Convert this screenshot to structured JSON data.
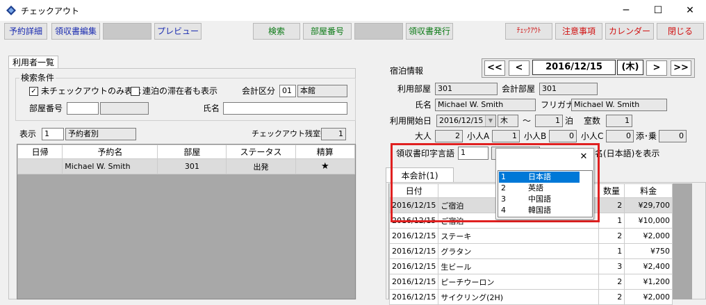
{
  "window": {
    "title": "チェックアウト",
    "minimize": "─",
    "maximize": "☐",
    "close": "✕"
  },
  "toolbar": {
    "reservation_detail": "予約詳細",
    "receipt_edit": "領収書編集",
    "preview": "プレビュー",
    "search": "検索",
    "room_number": "部屋番号",
    "issue_receipt": "領収書発行",
    "checkout": "ﾁｪｯｸｱｳﾄ",
    "notes": "注意事項",
    "calendar": "カレンダー",
    "close": "閉じる"
  },
  "left": {
    "tab": "利用者一覧",
    "search_group": "検索条件",
    "chk_unchecked_only": "未チェックアウトのみ表示",
    "chk_unchecked_only_checked": "✓",
    "chk_consecutive": "連泊の滞在者も表示",
    "account_label": "会計区分",
    "account_code": "01",
    "account_name": "本館",
    "room_label": "部屋番号",
    "name_label": "氏名",
    "display_label": "表示",
    "display_value": "1",
    "display_name": "予約者別",
    "remaining_label": "チェックアウト残室数",
    "remaining_value": "1",
    "headers": [
      "日帰",
      "予約名",
      "部屋",
      "ステータス",
      "精算"
    ],
    "rows": [
      {
        "day": "",
        "name": "Michael W. Smith",
        "room": "301",
        "status": "出発",
        "paid": "★"
      }
    ]
  },
  "right": {
    "stay_info": "宿泊情報",
    "nav": {
      "first": "<<",
      "prev": "<",
      "date": "2016/12/15",
      "dow": "(木)",
      "next": ">",
      "last": ">>"
    },
    "room_label": "利用部屋",
    "room_value": "301",
    "acct_room_label": "会計部屋",
    "acct_room_value": "301",
    "name_label": "氏名",
    "name_value": "Michael W. Smith",
    "furigana_label": "フリガナ",
    "furigana_value": "Michael W. Smith",
    "start_label": "利用開始日",
    "start_value": "2016/12/15",
    "start_dow": "木",
    "tilde": "～",
    "nights_value": "1",
    "nights_label": "泊",
    "rooms_label": "室数",
    "rooms_value": "1",
    "adult_label": "大人",
    "adult_value": "2",
    "childA_label": "小人A",
    "childA_value": "1",
    "childB_label": "小人B",
    "childB_value": "0",
    "childC_label": "小人C",
    "childC_value": "0",
    "bed_label": "添･乗",
    "bed_value": "0",
    "lang_label": "領収書印字言語",
    "lang_value": "1",
    "lang_hint": "名(日本語)を表示",
    "popup_close": "✕",
    "languages": [
      {
        "code": "1",
        "name": "日本語"
      },
      {
        "code": "2",
        "name": "英語"
      },
      {
        "code": "3",
        "name": "中国語"
      },
      {
        "code": "4",
        "name": "韓国語"
      }
    ],
    "tab": "本会計(1)",
    "bill_headers": [
      "日付",
      "数量",
      "料金"
    ],
    "bill_rows": [
      {
        "date": "2016/12/15",
        "item": "ご宿泊",
        "qty": "2",
        "price": "¥29,700"
      },
      {
        "date": "2016/12/15",
        "item": "ご宿泊",
        "qty": "1",
        "price": "¥10,000"
      },
      {
        "date": "2016/12/15",
        "item": "ステーキ",
        "qty": "2",
        "price": "¥2,000"
      },
      {
        "date": "2016/12/15",
        "item": "グラタン",
        "qty": "1",
        "price": "¥750"
      },
      {
        "date": "2016/12/15",
        "item": "生ビール",
        "qty": "3",
        "price": "¥2,400"
      },
      {
        "date": "2016/12/15",
        "item": "ピーチウーロン",
        "qty": "2",
        "price": "¥1,200"
      },
      {
        "date": "2016/12/15",
        "item": "サイクリング(2H)",
        "qty": "2",
        "price": "¥2,000"
      }
    ]
  },
  "colors": {
    "highlight": "#e02020",
    "select": "#0078d7"
  }
}
